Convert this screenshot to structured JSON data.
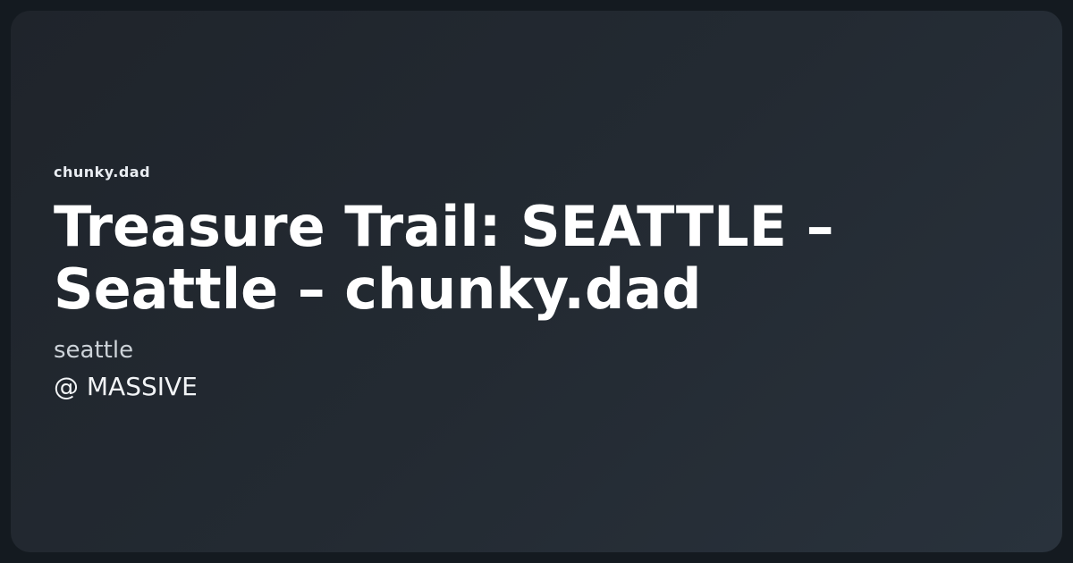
{
  "card": {
    "site_name": "chunky.dad",
    "title": "Treasure Trail: SEATTLE – Seattle – chunky.dad",
    "city": "seattle",
    "venue": "@ MASSIVE"
  }
}
